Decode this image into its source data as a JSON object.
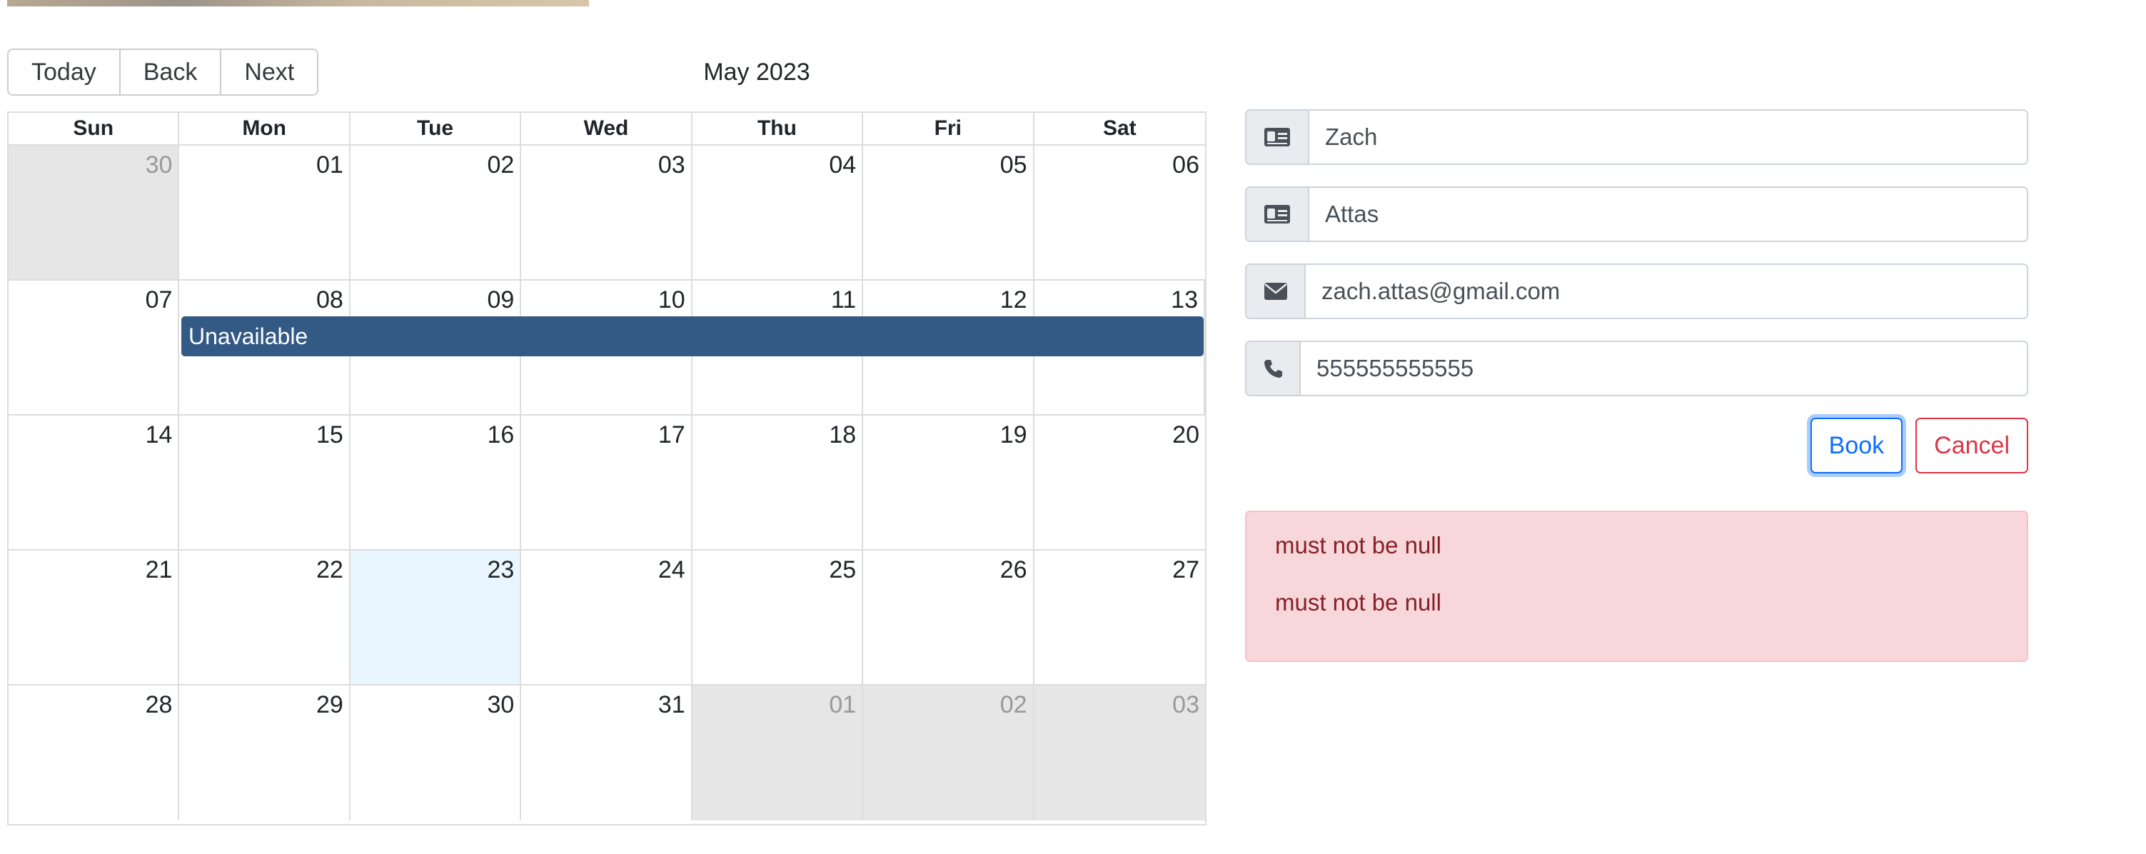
{
  "toolbar": {
    "today": "Today",
    "back": "Back",
    "next": "Next"
  },
  "calendar": {
    "title": "May 2023",
    "days_of_week": [
      "Sun",
      "Mon",
      "Tue",
      "Wed",
      "Thu",
      "Fri",
      "Sat"
    ],
    "weeks": [
      [
        {
          "n": "30",
          "off": true
        },
        {
          "n": "01"
        },
        {
          "n": "02"
        },
        {
          "n": "03"
        },
        {
          "n": "04"
        },
        {
          "n": "05"
        },
        {
          "n": "06"
        }
      ],
      [
        {
          "n": "07"
        },
        {
          "n": "08"
        },
        {
          "n": "09"
        },
        {
          "n": "10"
        },
        {
          "n": "11"
        },
        {
          "n": "12"
        },
        {
          "n": "13"
        }
      ],
      [
        {
          "n": "14"
        },
        {
          "n": "15"
        },
        {
          "n": "16"
        },
        {
          "n": "17"
        },
        {
          "n": "18"
        },
        {
          "n": "19"
        },
        {
          "n": "20"
        }
      ],
      [
        {
          "n": "21"
        },
        {
          "n": "22"
        },
        {
          "n": "23",
          "today": true
        },
        {
          "n": "24"
        },
        {
          "n": "25"
        },
        {
          "n": "26"
        },
        {
          "n": "27"
        }
      ],
      [
        {
          "n": "28"
        },
        {
          "n": "29"
        },
        {
          "n": "30"
        },
        {
          "n": "31"
        },
        {
          "n": "01",
          "off": true
        },
        {
          "n": "02",
          "off": true
        },
        {
          "n": "03",
          "off": true
        }
      ]
    ],
    "event": {
      "label": "Unavailable",
      "color": "#335a85"
    }
  },
  "form": {
    "first_name": {
      "value": "Zach",
      "icon": "id-card-icon"
    },
    "last_name": {
      "value": "Attas",
      "icon": "id-card-icon"
    },
    "email": {
      "value": "zach.attas@gmail.com",
      "icon": "envelope-icon"
    },
    "phone": {
      "value": "555555555555",
      "icon": "phone-icon"
    },
    "book_label": "Book",
    "cancel_label": "Cancel"
  },
  "errors": [
    "must not be null",
    "must not be null"
  ],
  "colors": {
    "primary": "#0d6efd",
    "danger": "#dc3545",
    "alert_bg": "#f8d7da",
    "event": "#335a85"
  }
}
